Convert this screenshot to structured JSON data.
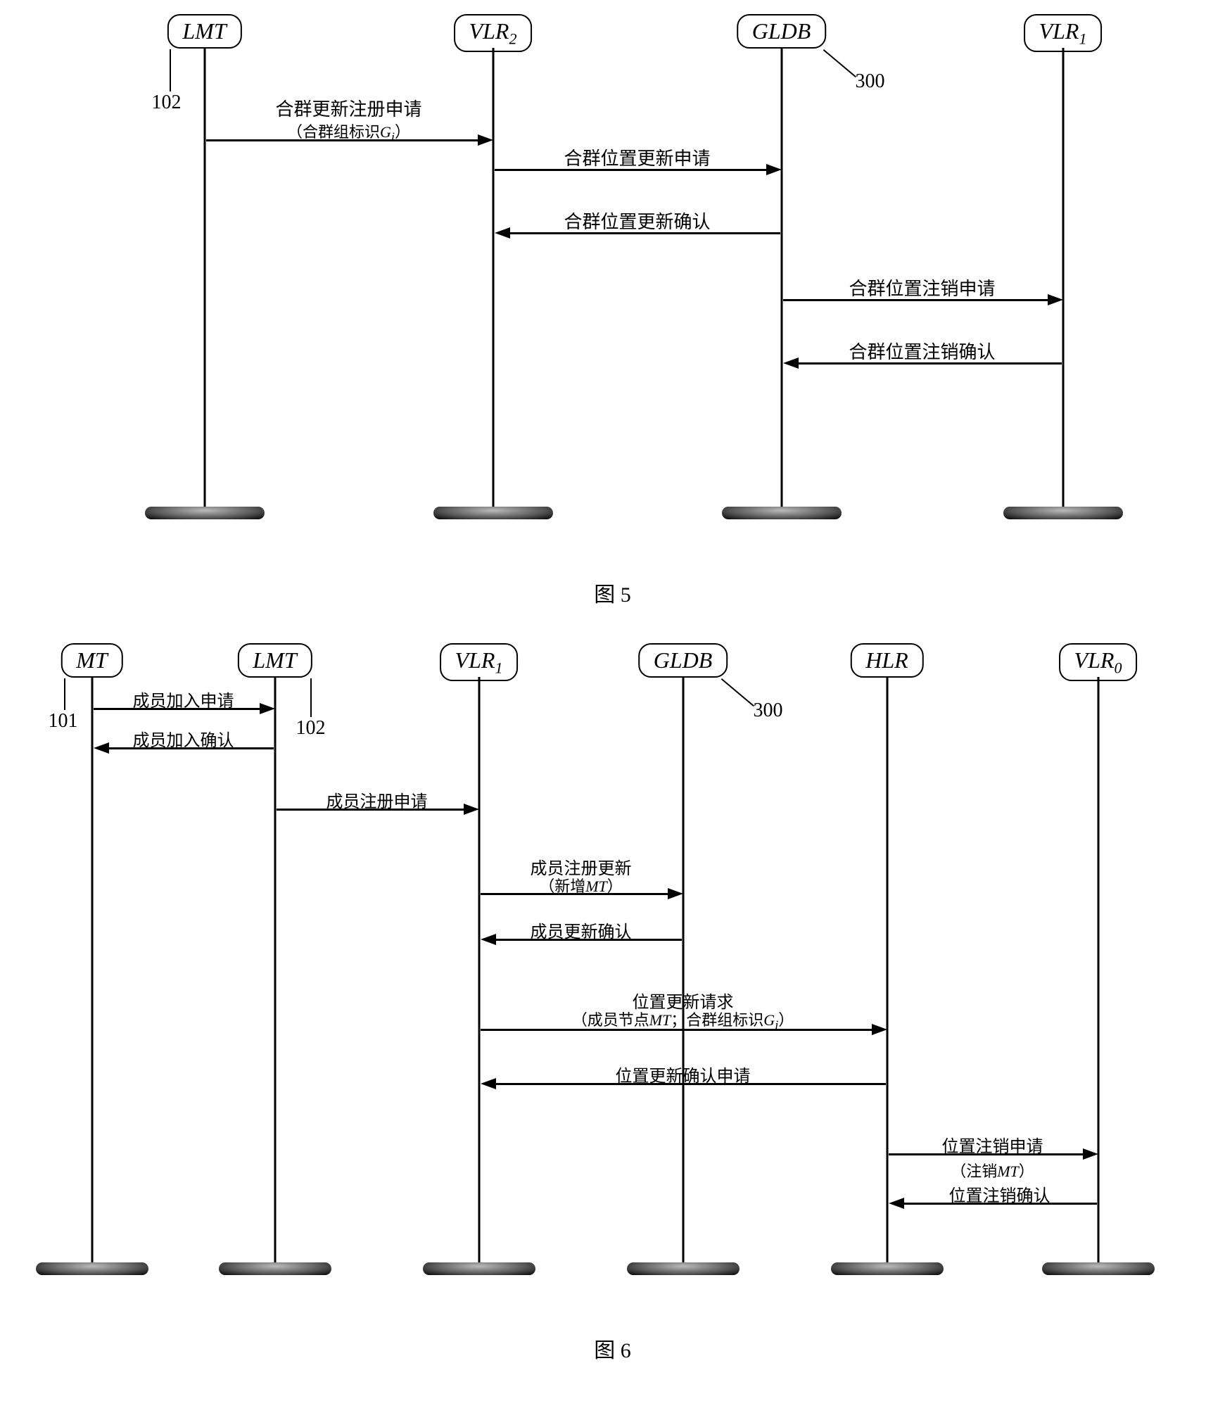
{
  "fig5": {
    "caption": "图 5",
    "lifelines": {
      "lmt": "LMT",
      "vlr2": "VLR",
      "vlr2_sub": "2",
      "gldb": "GLDB",
      "vlr1": "VLR",
      "vlr1_sub": "1"
    },
    "tags": {
      "lmt": "102",
      "gldb": "300"
    },
    "messages": {
      "m1": "合群更新注册申请",
      "m1_sub_a": "（合群组标识",
      "m1_sub_b": "G",
      "m1_sub_c": "i",
      "m1_sub_d": "）",
      "m2": "合群位置更新申请",
      "m3": "合群位置更新确认",
      "m4": "合群位置注销申请",
      "m5": "合群位置注销确认"
    }
  },
  "fig6": {
    "caption": "图 6",
    "lifelines": {
      "mt": "MT",
      "lmt": "LMT",
      "vlr1": "VLR",
      "vlr1_sub": "1",
      "gldb": "GLDB",
      "hlr": "HLR",
      "vlr0": "VLR",
      "vlr0_sub": "0"
    },
    "tags": {
      "mt": "101",
      "lmt": "102",
      "gldb": "300"
    },
    "messages": {
      "m1": "成员加入申请",
      "m2": "成员加入确认",
      "m3": "成员注册申请",
      "m4": "成员注册更新",
      "m4_sub_a": "（新增",
      "m4_sub_b": "MT",
      "m4_sub_c": "）",
      "m5": "成员更新确认",
      "m6": "位置更新请求",
      "m6_sub_a": "（成员节点",
      "m6_sub_b": "MT",
      "m6_sub_c": "；合群组标识",
      "m6_sub_d": "G",
      "m6_sub_e": "i",
      "m6_sub_f": "）",
      "m7": "位置更新确认申请",
      "m8": "位置注销申请",
      "m8_sub_a": "（注销",
      "m8_sub_b": "MT",
      "m8_sub_c": "）",
      "m9": "位置注销确认"
    }
  }
}
